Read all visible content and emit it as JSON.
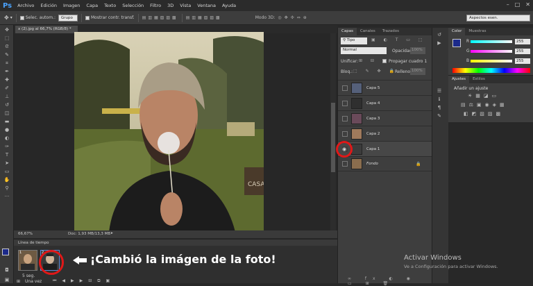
{
  "app": {
    "logo": "Ps"
  },
  "menu": [
    "Archivo",
    "Edición",
    "Imagen",
    "Capa",
    "Texto",
    "Selección",
    "Filtro",
    "3D",
    "Vista",
    "Ventana",
    "Ayuda"
  ],
  "options_bar": {
    "auto_select_label": "Selec. autom.:",
    "group_value": "Grupo",
    "show_transform_label": "Mostrar contr. transf.",
    "mode3d_label": "Modo 3D:",
    "workspace_value": "Aspectos esen."
  },
  "document": {
    "tab_title": "x (2).jpg al 66,7% (RGB/8) *"
  },
  "status": {
    "zoom": "66,67%",
    "doc_info": "Doc: 1,93 MB/13,3 MB"
  },
  "timeline": {
    "title": "Línea de tiempo",
    "frame_delay": "5 seg.",
    "loop": "Una vez",
    "frames": [
      {
        "number": "1"
      },
      {
        "number": "2"
      }
    ]
  },
  "layers_panel": {
    "tabs": [
      "Capas",
      "Canales",
      "Trazados"
    ],
    "kind_filter": "Tipo",
    "blend_mode": "Normal",
    "opacity_label": "Opacidad:",
    "opacity_value": "100%",
    "unify_label": "Unificar:",
    "propagate_label": "Propagar cuadro 1",
    "lock_label": "Bloq.:",
    "fill_label": "Relleno:",
    "fill_value": "100%",
    "layers": [
      {
        "name": "Capa 5"
      },
      {
        "name": "Capa 4"
      },
      {
        "name": "Capa 3"
      },
      {
        "name": "Capa 2"
      },
      {
        "name": "Capa 1"
      },
      {
        "name": "Fondo"
      }
    ]
  },
  "color_panel": {
    "tabs": [
      "Color",
      "Muestras"
    ],
    "r_label": "R",
    "r_value": "255",
    "g_label": "G",
    "g_value": "255",
    "b_label": "B",
    "b_value": "255"
  },
  "adjust_panel": {
    "tabs": [
      "Ajustes",
      "Estilos"
    ],
    "title": "Añadir un ajuste"
  },
  "annotation": "¡Cambió la imágen de la foto!",
  "watermark": {
    "line1": "Activar Windows",
    "line2": "Ve a Configuración para activar Windows."
  },
  "colors": {
    "accent": "#4aa3ff",
    "highlight": "#e01818"
  }
}
